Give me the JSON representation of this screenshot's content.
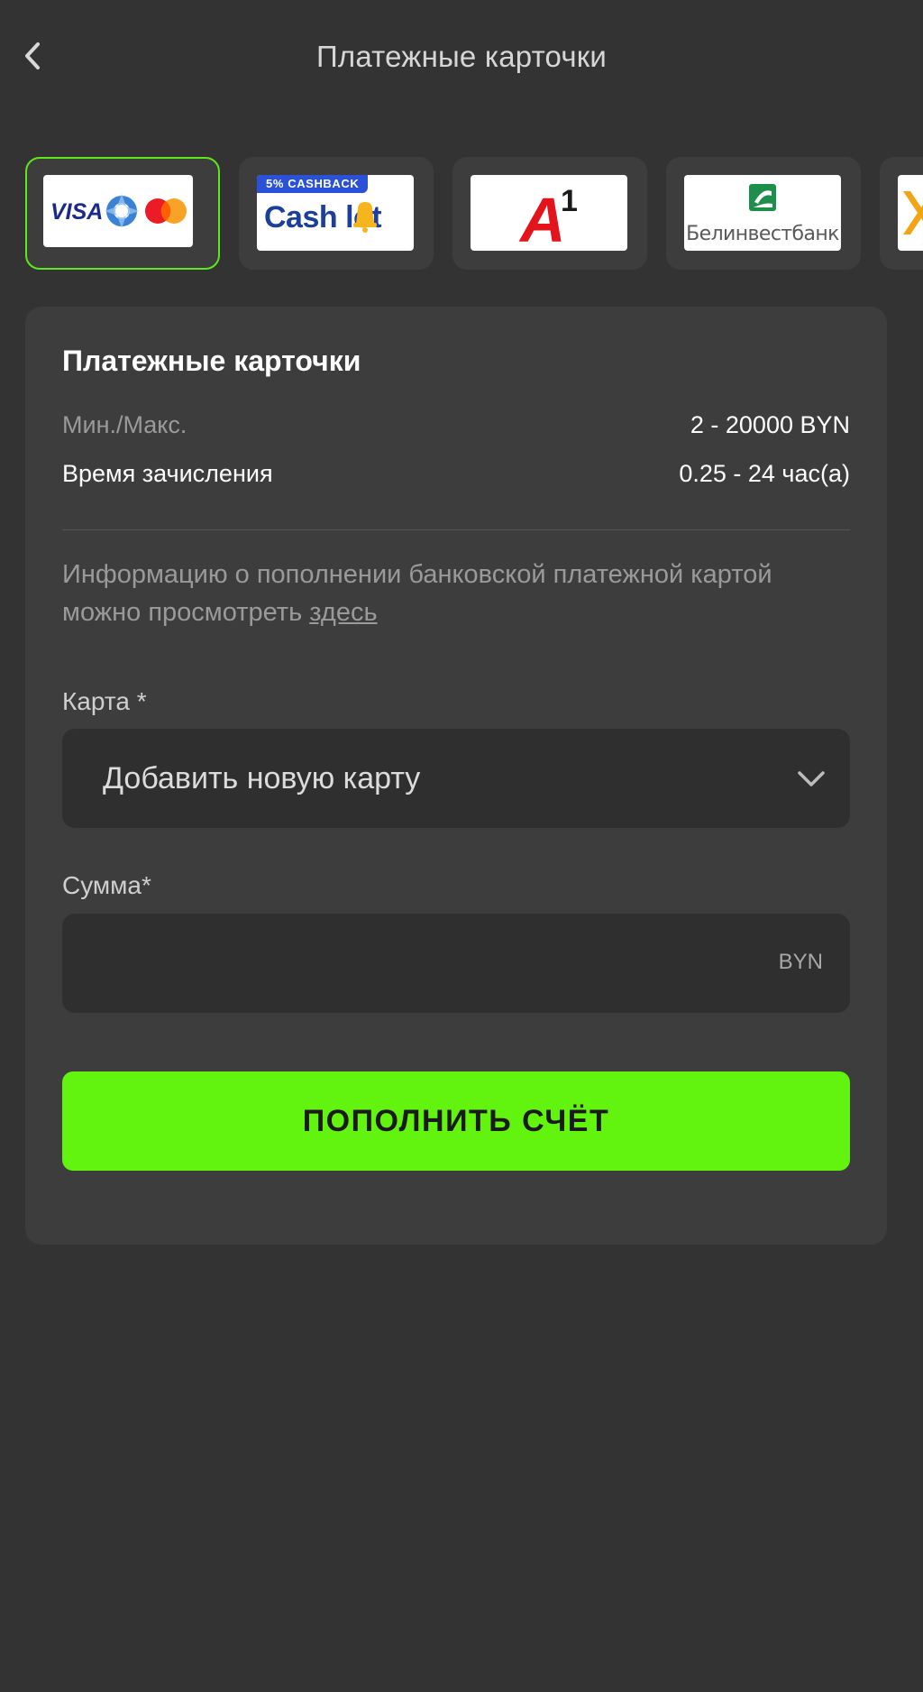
{
  "header": {
    "title": "Платежные карточки",
    "back_icon": "chevron-left-icon"
  },
  "methods": [
    {
      "name": "VISA / Mastercard",
      "logo_text": "VISA",
      "selected": true
    },
    {
      "name": "Cashalot",
      "badge": "5% CASHBACK",
      "logo_text": "Cash  lot",
      "selected": false
    },
    {
      "name": "A1",
      "logo_text": "A",
      "logo_superscript": "1",
      "selected": false
    },
    {
      "name": "Белинвестбанк",
      "logo_text": "Белинвестбанк",
      "selected": false
    },
    {
      "name": "partial",
      "selected": false
    }
  ],
  "card": {
    "title": "Платежные карточки",
    "limits_label": "Мин./Макс.",
    "limits_value": "2 - 20000 BYN",
    "time_label": "Время зачисления",
    "time_value": "0.25 - 24 час(а)",
    "info_text": "Информацию о пополнении банковской платежной картой можно просмотреть ",
    "info_link": "здесь",
    "card_label": "Карта *",
    "card_select_value": "Добавить новую карту",
    "sum_label": "Сумма*",
    "sum_value": "",
    "sum_currency": "BYN",
    "submit_label": "ПОПОЛНИТЬ СЧЁТ"
  },
  "colors": {
    "background": "#333333",
    "card": "#3d3d3d",
    "accent": "#62f30f",
    "selected_border": "#5ee81b"
  }
}
